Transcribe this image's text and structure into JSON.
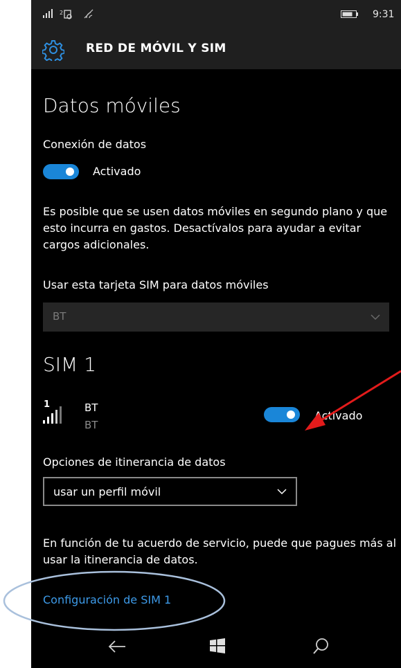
{
  "status": {
    "time": "9:31"
  },
  "header": {
    "title": "RED DE MÓVIL Y SIM",
    "icon": "gear-icon"
  },
  "mobile_data": {
    "heading": "Datos móviles",
    "connection_label": "Conexión de datos",
    "connection_toggle": "Activado",
    "notice": "Es posible que se usen datos móviles en segundo plano y que esto incurra en gastos. Desactívalos para ayudar a evitar cargos adicionales.",
    "sim_select_label": "Usar esta tarjeta SIM para datos móviles",
    "sim_select_value": "BT"
  },
  "sim1": {
    "heading": "SIM 1",
    "slot_number": "1",
    "carrier": "BT",
    "carrier_sub": "BT",
    "toggle_label": "Activado",
    "roaming_label": "Opciones de itinerancia de datos",
    "roaming_value": "usar un perfil móvil",
    "roaming_notice": "En función de tu acuerdo de servicio, puede que pagues más al usar la itinerancia de datos.",
    "settings_link": "Configuración de SIM 1"
  },
  "colors": {
    "accent": "#1a86d8",
    "annotation_arrow": "#e21b1b",
    "annotation_ellipse": "#a9c0dc"
  }
}
